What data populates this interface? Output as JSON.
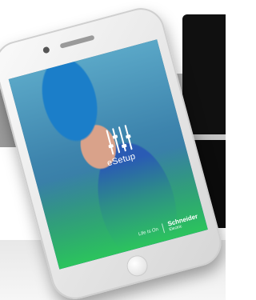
{
  "app": {
    "name": "eSetup",
    "tagline": "Life Is On",
    "brand_name": "Schneider",
    "brand_sub": "Electric",
    "accent_color": "#2cc45d"
  },
  "icons": {
    "logo": "esetup-logo-icon",
    "home_button": "home-button-icon"
  }
}
